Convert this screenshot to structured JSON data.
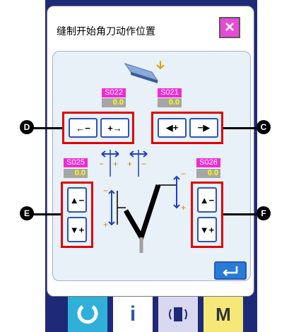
{
  "dialog": {
    "title": "缝制开始角刀动作位置",
    "close_label": "×"
  },
  "params": {
    "s022": {
      "code": "S022",
      "value": "0.0"
    },
    "s021": {
      "code": "S021",
      "value": "0.0"
    },
    "s025": {
      "code": "S025",
      "value": "0.0"
    },
    "s026": {
      "code": "S026",
      "value": "0.0"
    }
  },
  "callouts": {
    "d": "D",
    "c": "C",
    "e": "E",
    "f": "F"
  },
  "buttons": {
    "left_minus": "←−",
    "left_plus": "+→",
    "right_left_plus": "◀+",
    "right_minus_right": "−▶",
    "up_minus": "▲−",
    "down_plus": "▼+"
  },
  "taskbar": {
    "info_label": "i",
    "m_label": "M"
  },
  "colors": {
    "accent_pink": "#f02bd2",
    "frame_blue": "#1e2a78",
    "button_border": "#2a56b8",
    "callout_red": "#e00000",
    "value_yellow": "#ffff00"
  }
}
